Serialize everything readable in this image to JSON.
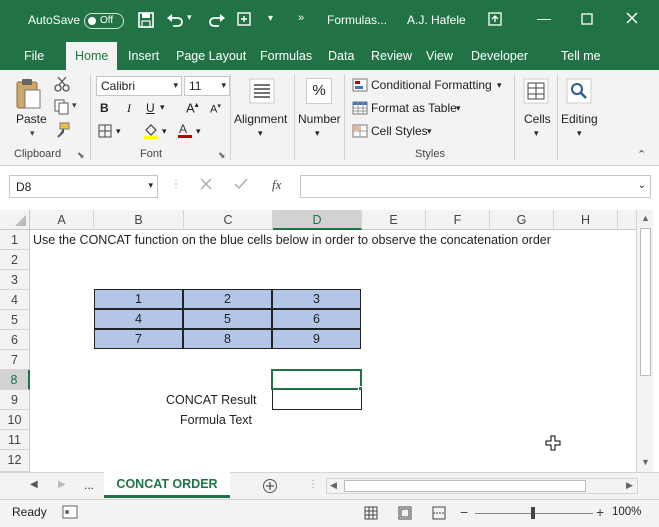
{
  "titlebar": {
    "autosave_label": "AutoSave",
    "autosave_state": "Off",
    "doc_title": "Formulas...",
    "user_name": "A.J. Hafele"
  },
  "tabs": [
    "File",
    "Home",
    "Insert",
    "Page Layout",
    "Formulas",
    "Data",
    "Review",
    "View",
    "Developer",
    "Tell me"
  ],
  "active_tab": "Home",
  "ribbon": {
    "clipboard": {
      "paste": "Paste",
      "label": "Clipboard"
    },
    "font": {
      "name": "Calibri",
      "size": "11",
      "bold": "B",
      "italic": "I",
      "underline": "U",
      "label": "Font"
    },
    "alignment": {
      "label": "Alignment"
    },
    "number": {
      "label": "Number",
      "symbol": "%"
    },
    "styles": {
      "conditional": "Conditional Formatting",
      "format_table": "Format as Table",
      "cell_styles": "Cell Styles",
      "label": "Styles"
    },
    "cells": {
      "label": "Cells"
    },
    "editing": {
      "label": "Editing"
    }
  },
  "formula_bar": {
    "name_box": "D8",
    "fx": "fx",
    "value": ""
  },
  "columns": [
    "A",
    "B",
    "C",
    "D",
    "E",
    "F",
    "G",
    "H"
  ],
  "selected_column": "D",
  "rows": [
    "1",
    "2",
    "3",
    "4",
    "5",
    "6",
    "7",
    "8",
    "9",
    "10",
    "11",
    "12"
  ],
  "selected_row": "8",
  "cells": {
    "a1": "Use the CONCAT function on the blue cells below in order to observe the concatenation order",
    "grid": [
      [
        "1",
        "2",
        "3"
      ],
      [
        "4",
        "5",
        "6"
      ],
      [
        "7",
        "8",
        "9"
      ]
    ],
    "c9": "CONCAT Result",
    "c10": "Formula Text"
  },
  "sheet": {
    "ellipsis": "...",
    "active_sheet": "CONCAT ORDER"
  },
  "status": {
    "ready": "Ready",
    "zoom": "100%"
  },
  "colors": {
    "accent": "#217346",
    "blue_fill": "#b4c6e7"
  }
}
